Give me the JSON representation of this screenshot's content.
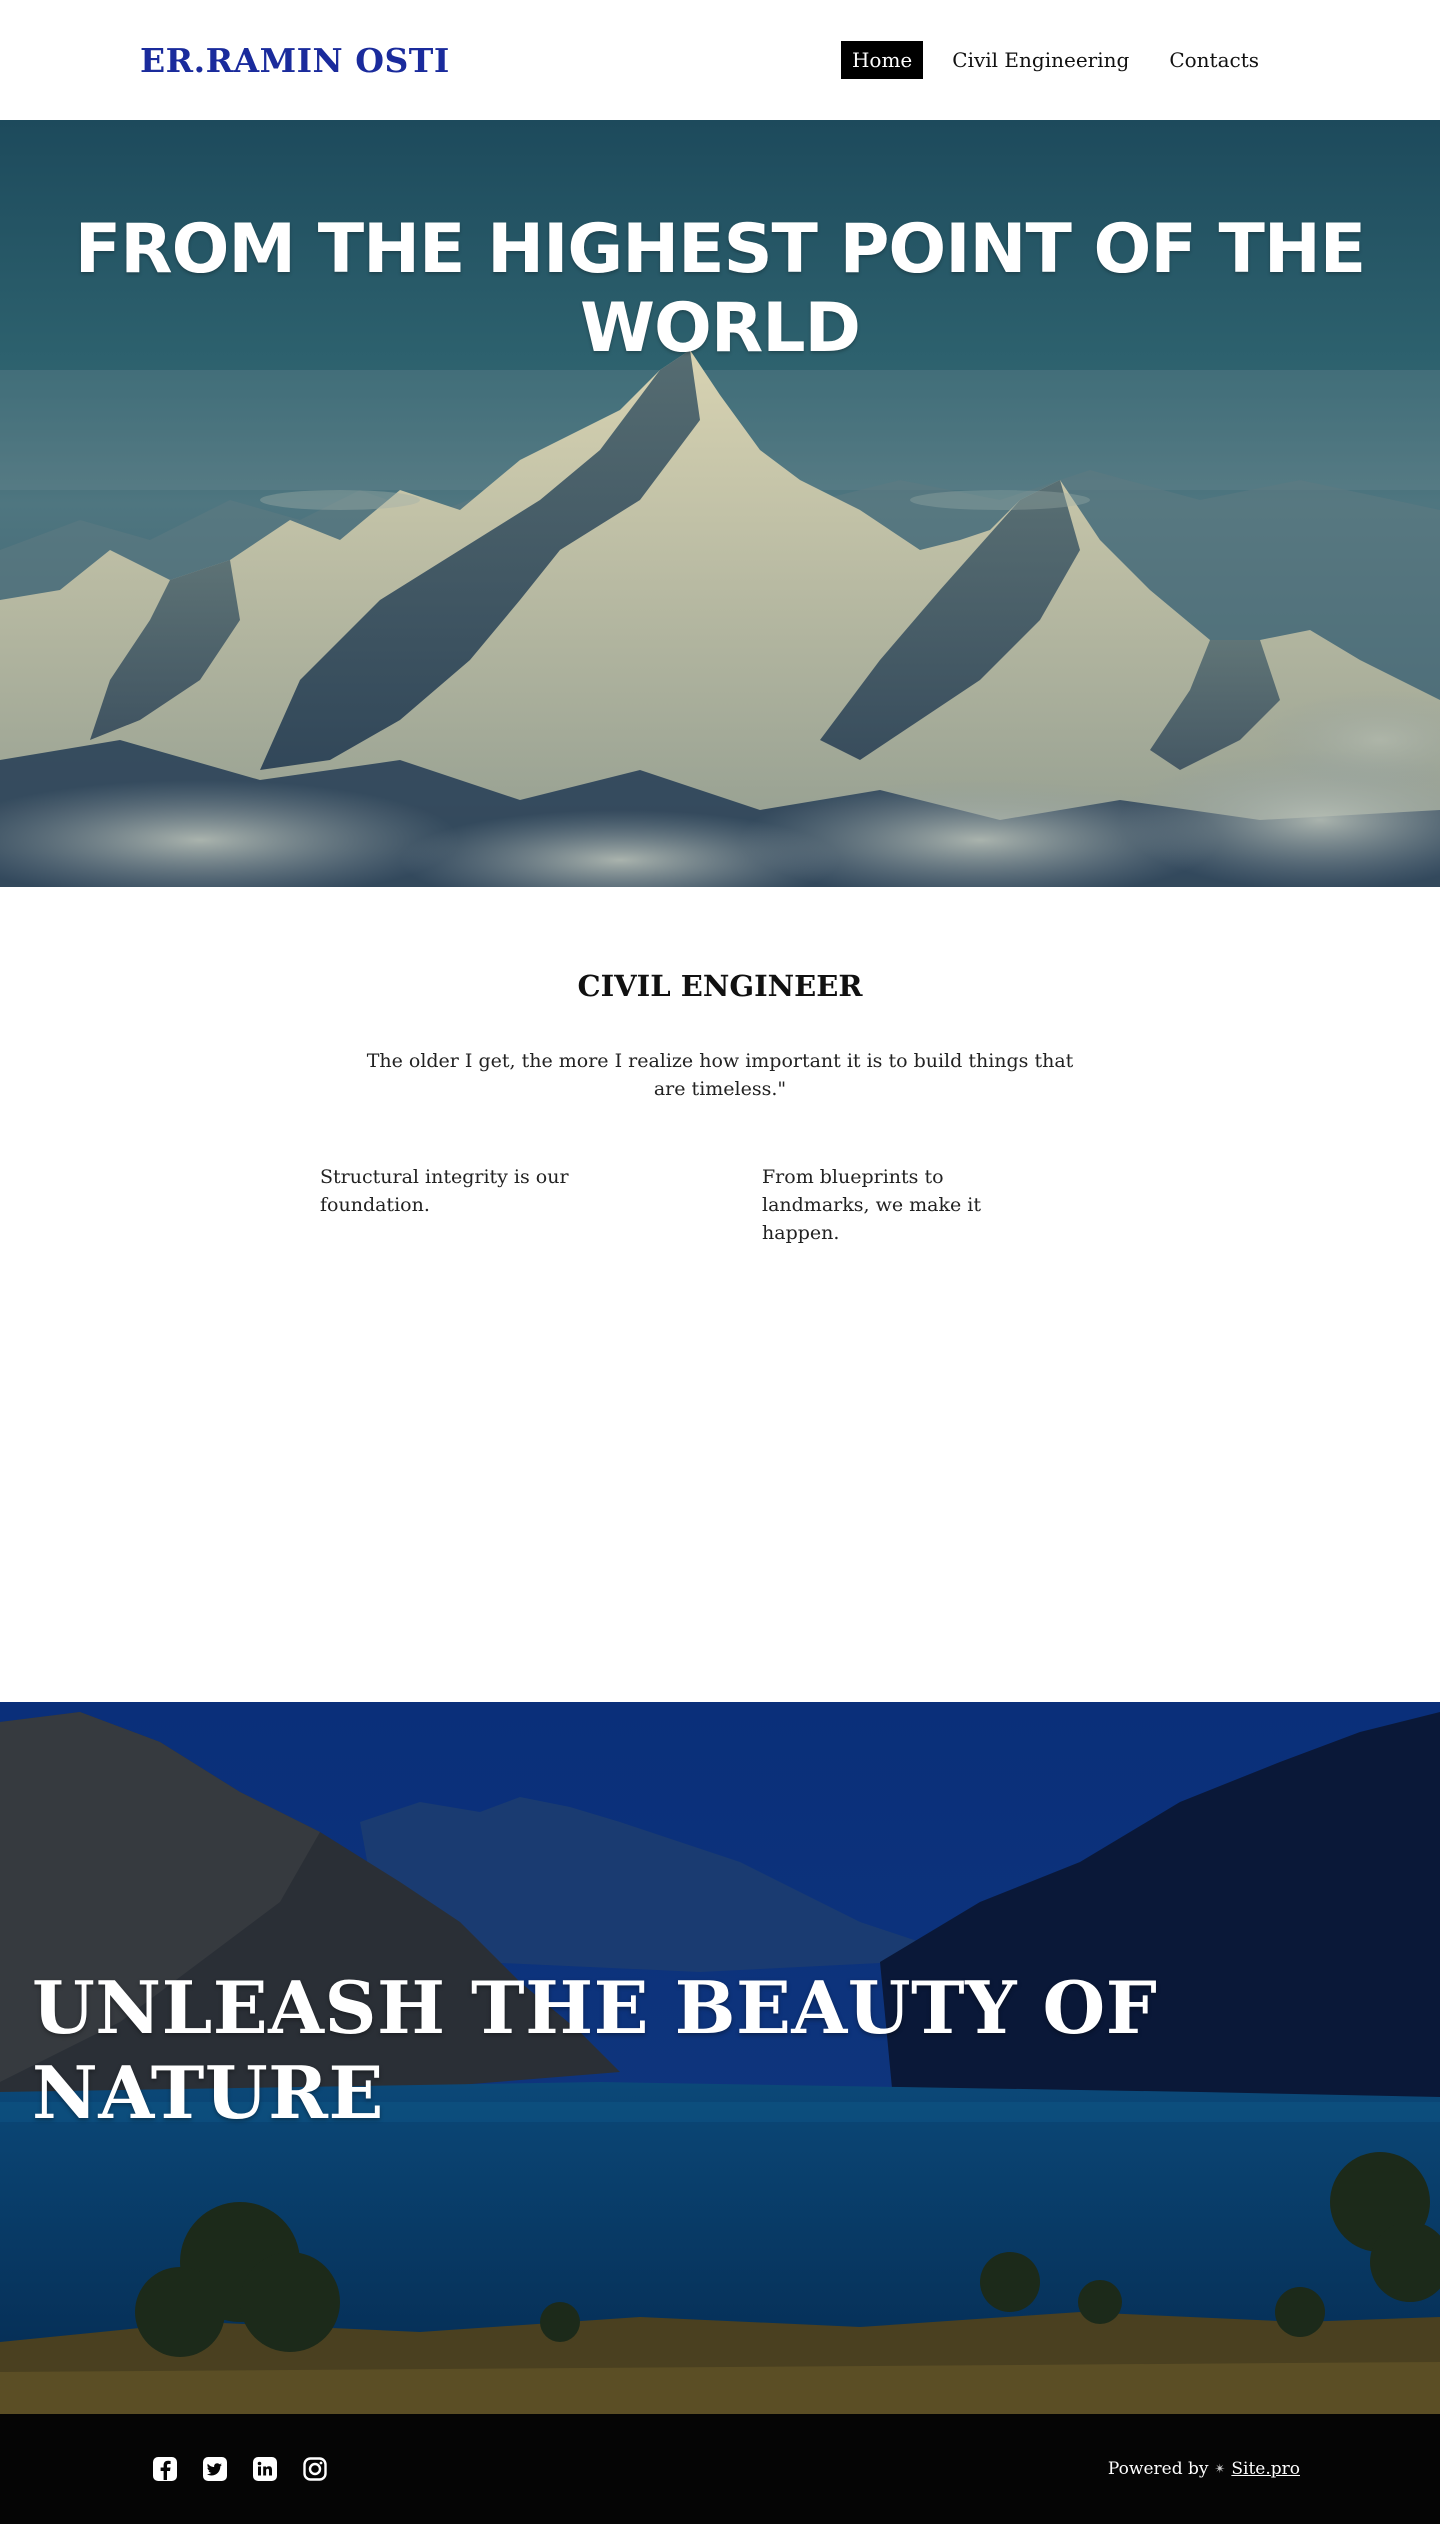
{
  "header": {
    "brand": "ER.RAMIN OSTI",
    "nav": [
      {
        "label": "Home",
        "active": true
      },
      {
        "label": "Civil Engineering",
        "active": false
      },
      {
        "label": "Contacts",
        "active": false
      }
    ]
  },
  "hero": {
    "title": "FROM THE HIGHEST POINT OF THE WORLD",
    "image": "mountain-range-above-clouds"
  },
  "intro": {
    "heading": "CIVIL ENGINEER",
    "quote": "The older I get, the more I realize how important it is to build things that are timeless.\"",
    "columns": [
      "Structural integrity is our foundation.",
      "From blueprints to landmarks, we make it happen."
    ]
  },
  "nature": {
    "title": "UNLEASH THE BEAUTY OF NATURE",
    "image": "mountain-lake-valley"
  },
  "footer": {
    "social": [
      {
        "name": "facebook-icon"
      },
      {
        "name": "twitter-icon"
      },
      {
        "name": "linkedin-icon"
      },
      {
        "name": "instagram-icon"
      }
    ],
    "powered_by": "Powered by",
    "site_link": "Site.pro"
  },
  "colors": {
    "brand": "#1a2b9c",
    "nav_active_bg": "#000000",
    "footer_bg": "#050505"
  }
}
